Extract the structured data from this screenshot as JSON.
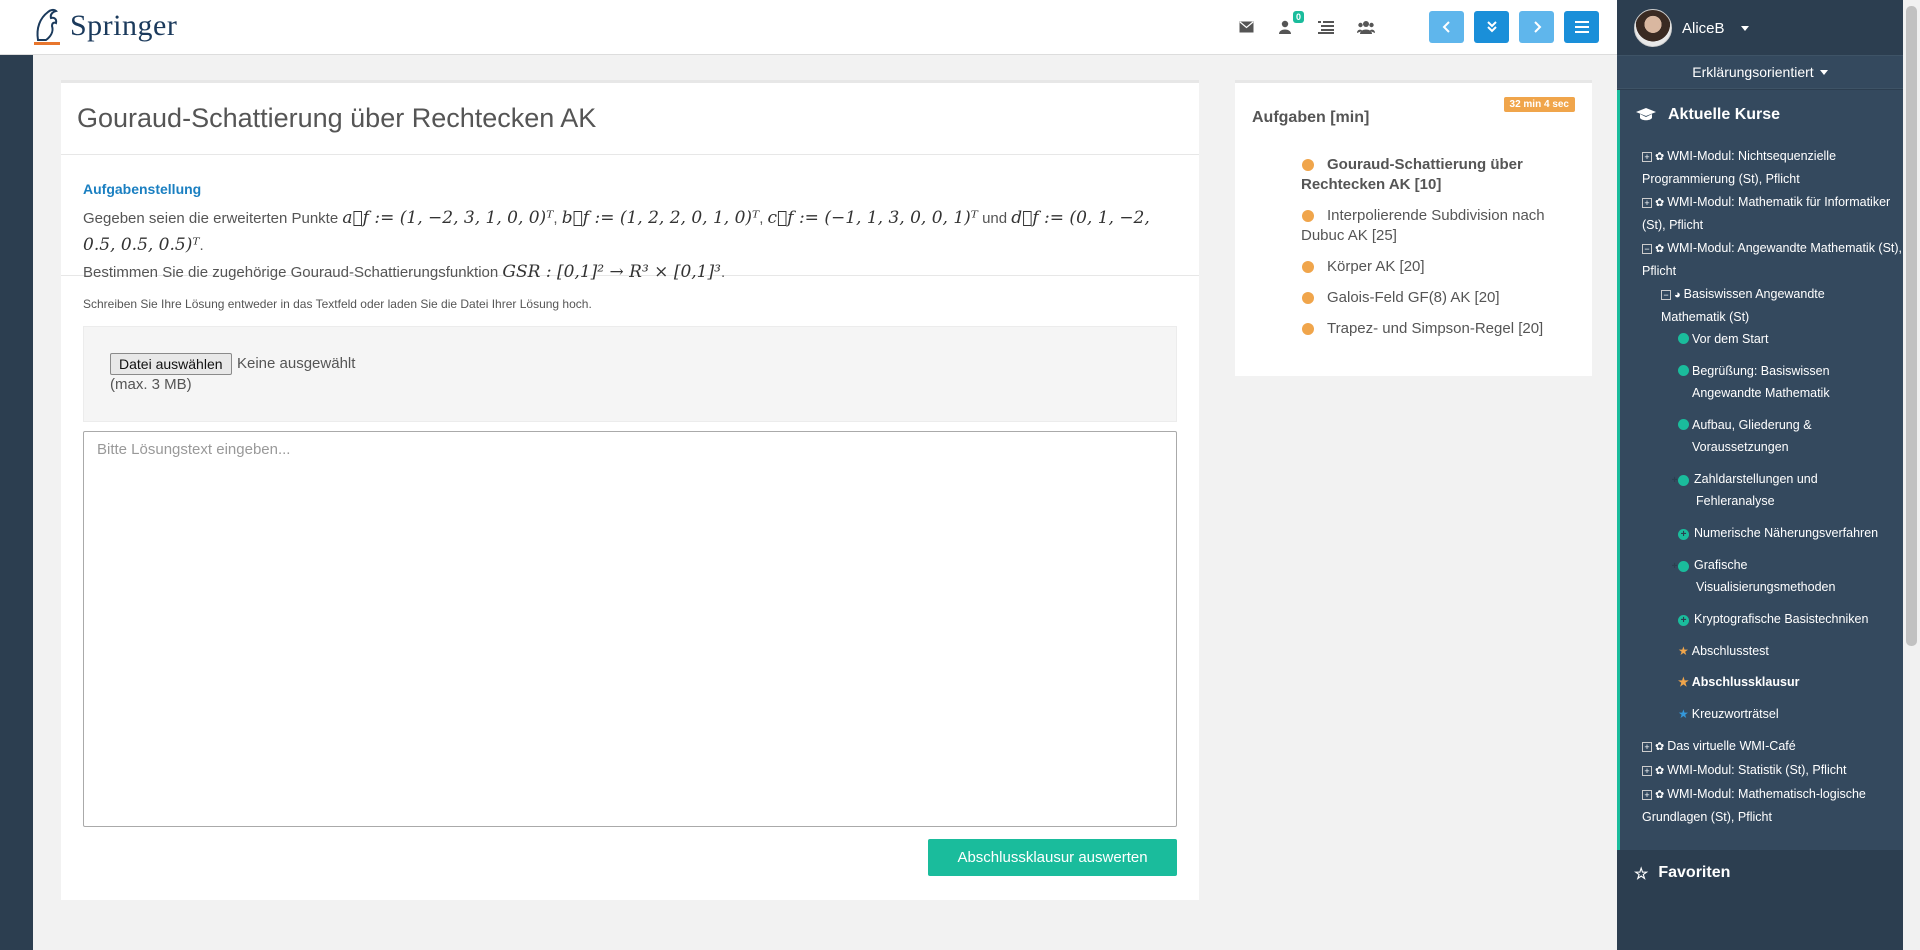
{
  "brand": {
    "name": "Springer"
  },
  "topbar": {
    "icons": [
      "envelope-icon",
      "user-badge-icon",
      "list-icon",
      "users-icon"
    ],
    "notification_count": "0",
    "nav": [
      "‹",
      "»",
      "›",
      "☰"
    ]
  },
  "exercise": {
    "title": "Gouraud-Schattierung über Rechtecken AK",
    "task_title": "Aufgabenstellung",
    "text_given": "Gegeben seien die erweiterten Punkte",
    "pt_a": "a⃗f := (1, −2, 3, 1, 0, 0)ᵀ",
    "pt_b": "b⃗f := (1, 2, 2, 0, 1, 0)ᵀ",
    "pt_c": "c⃗f := (−1, 1, 3, 0, 0, 1)ᵀ",
    "and": "und",
    "pt_d": "d⃗f := (0, 1, −2, 0.5, 0.5, 0.5)ᵀ",
    "text_determine": "Bestimmen Sie die zugehörige Gouraud-Schattierungsfunktion",
    "gsr": "GSR : [0,1]² → R³ × [0,1]³",
    "hint": "Schreiben Sie Ihre Lösung entweder in das Textfeld oder laden Sie die Datei Ihrer Lösung hoch.",
    "file_button": "Datei auswählen",
    "file_none": "Keine ausgewählt",
    "file_max": "(max. 3 MB)",
    "textarea_placeholder": "Bitte Lösungstext eingeben...",
    "submit": "Abschlussklausur auswerten"
  },
  "tasks": {
    "title": "Aufgaben [min]",
    "timer": "32 min 4 sec",
    "items": [
      "Gouraud-Schattierung über Rechtecken AK [10]",
      "Interpolierende Subdivision nach Dubuc AK [25]",
      "Körper AK [20]",
      "Galois-Feld GF(8) AK [20]",
      "Trapez- und Simpson-Regel [20]"
    ]
  },
  "sidebar": {
    "username": "AliceB",
    "mode": "Erklärungsorientiert",
    "courses_title": "Aktuelle Kurse",
    "favorites_title": "Favoriten",
    "courses": [
      "WMI-Modul: Nichtsequenzielle Programmierung (St), Pflicht",
      "WMI-Modul: Mathematik für Informatiker (St), Pflicht",
      "WMI-Modul: Angewandte Mathematik (St), Pflicht",
      "Basiswissen Angewandte Mathematik (St)",
      "Vor dem Start",
      "Begrüßung: Basiswissen Angewandte Mathematik",
      "Aufbau, Gliederung & Voraussetzungen",
      "Zahldarstellungen und Fehleranalyse",
      "Numerische Näherungsverfahren",
      "Grafische Visualisierungsmethoden",
      "Kryptografische Basistechniken",
      "Abschlusstest",
      "Abschlussklausur",
      "Kreuzworträtsel",
      "Das virtuelle WMI-Café",
      "WMI-Modul: Statistik (St), Pflicht",
      "WMI-Modul: Mathematisch-logische Grundlagen (St), Pflicht"
    ]
  },
  "colors": {
    "accent": "#1abc9c",
    "primary": "#1a8fd9",
    "orange": "#f0a54b",
    "sidebar": "#2c3e50"
  }
}
